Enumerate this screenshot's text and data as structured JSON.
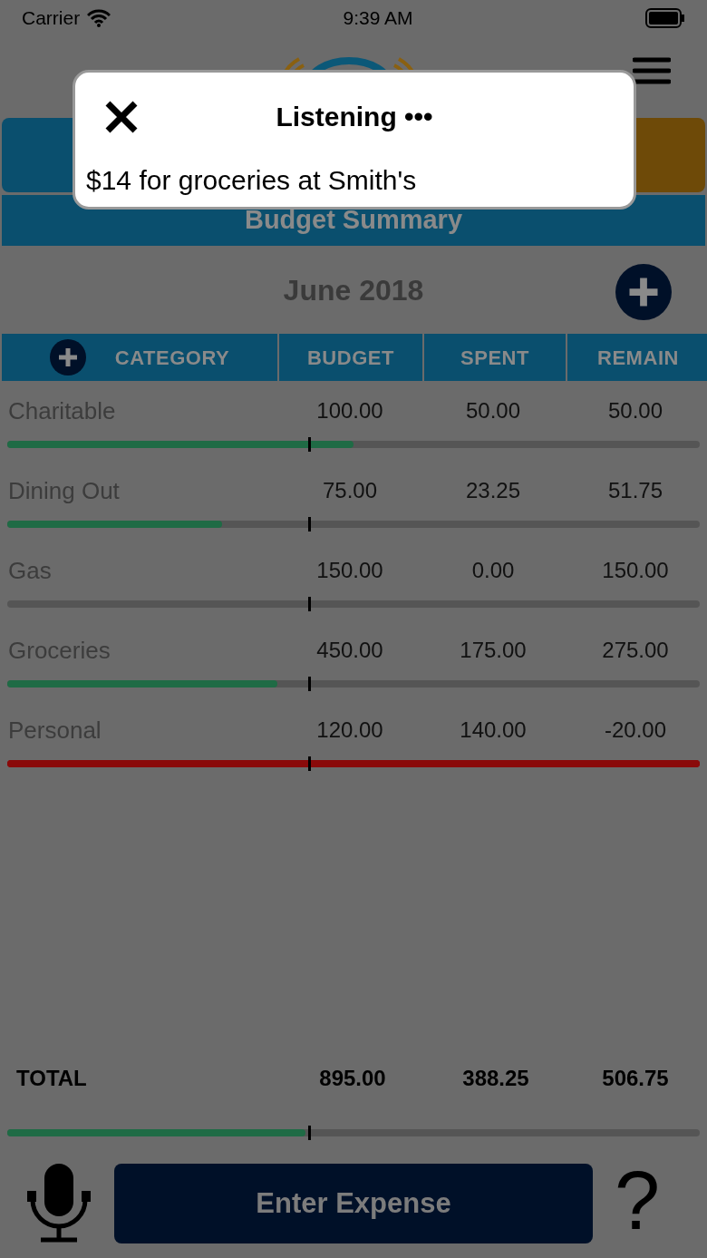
{
  "status_bar": {
    "carrier": "Carrier",
    "time": "9:39 AM"
  },
  "title_bar": {
    "heading": "Budget Summary"
  },
  "month": "June 2018",
  "table": {
    "columns": [
      "CATEGORY",
      "BUDGET",
      "SPENT",
      "REMAIN"
    ],
    "rows": [
      {
        "category": "Charitable",
        "budget": "100.00",
        "spent": "50.00",
        "remain": "50.00",
        "level": 0.5,
        "over_budget": false
      },
      {
        "category": "Dining Out",
        "budget": "75.00",
        "spent": "23.25",
        "remain": "51.75",
        "level": 0.31,
        "over_budget": false
      },
      {
        "category": "Gas",
        "budget": "150.00",
        "spent": "0.00",
        "remain": "150.00",
        "level": 0,
        "over_budget": false
      },
      {
        "category": "Groceries",
        "budget": "450.00",
        "spent": "175.00",
        "remain": "275.00",
        "level": 0.39,
        "over_budget": false
      },
      {
        "category": "Personal",
        "budget": "120.00",
        "spent": "140.00",
        "remain": "-20.00",
        "level": 1,
        "over_budget": true
      }
    ]
  },
  "total": {
    "label": "TOTAL",
    "budget": "895.00",
    "spent": "388.25",
    "remain": "506.75",
    "level": 0.43,
    "over_budget": false
  },
  "enter_button": "Enter Expense",
  "help": "?",
  "dialog": {
    "title": "Listening",
    "dots": "•••",
    "transcript": "$14 for groceries at Smith's"
  }
}
